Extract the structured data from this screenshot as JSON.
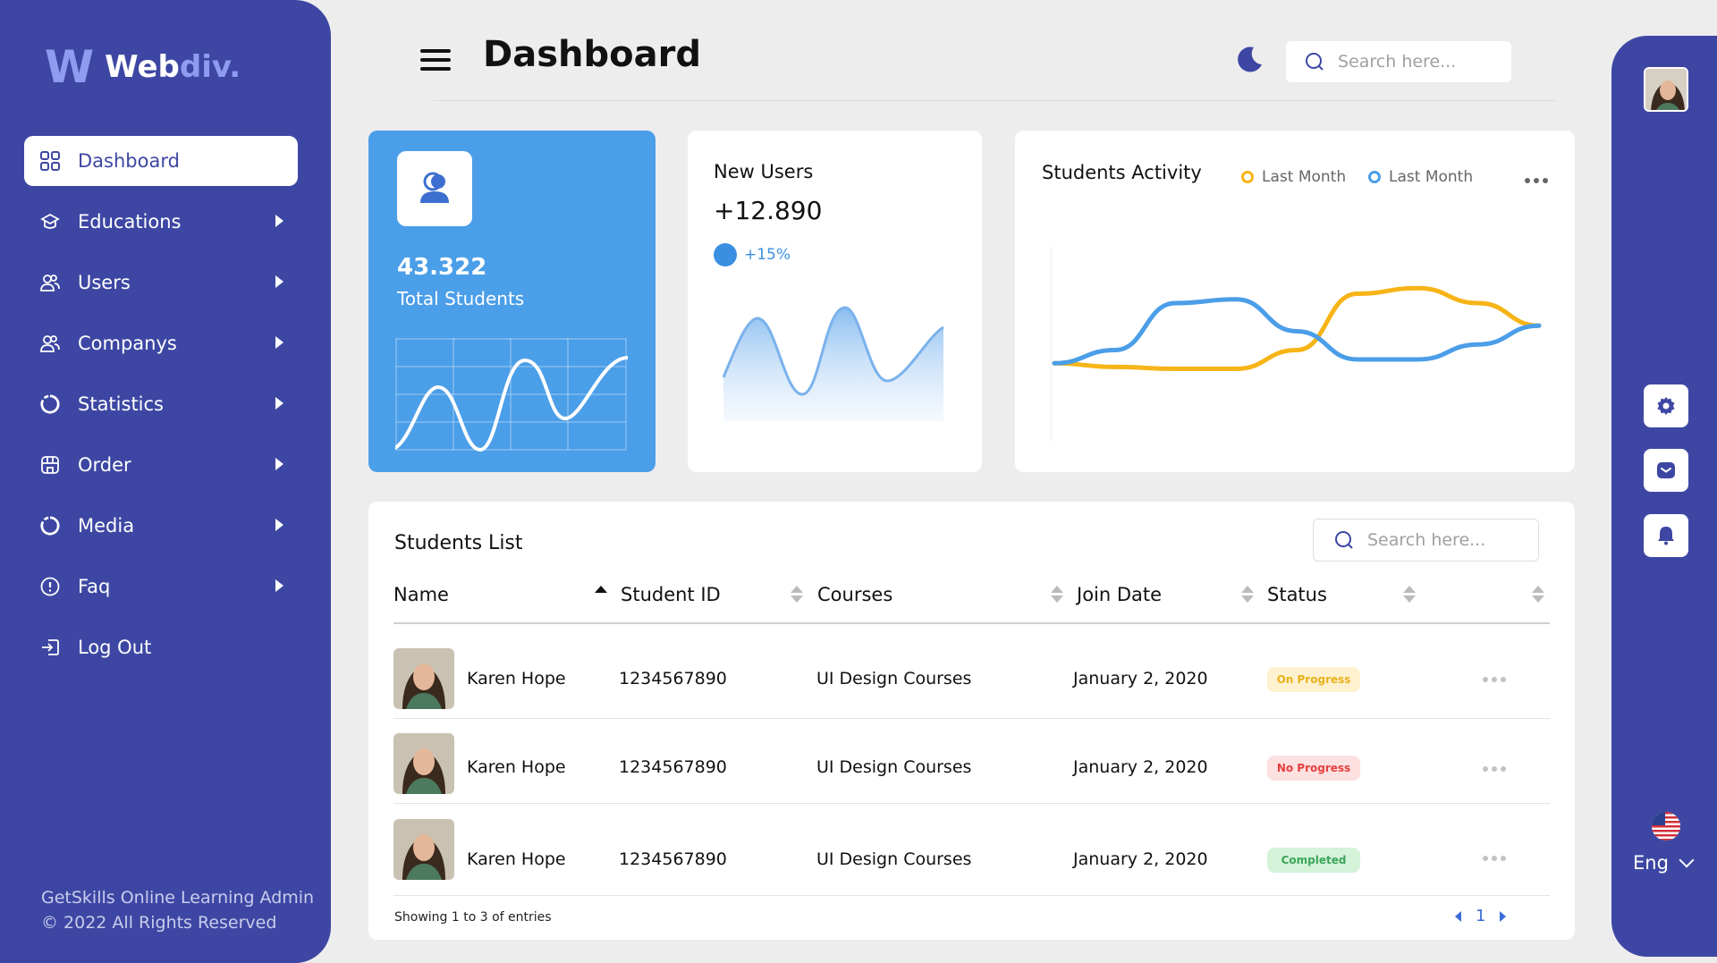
{
  "brand": {
    "mark": "W",
    "name_main": "Web",
    "name_accent": "div."
  },
  "sidebar": {
    "items": [
      {
        "label": "Dashboard",
        "icon": "grid-icon",
        "active": true
      },
      {
        "label": "Educations",
        "icon": "graduation-cap-icon"
      },
      {
        "label": "Users",
        "icon": "users-icon"
      },
      {
        "label": "Companys",
        "icon": "users-icon"
      },
      {
        "label": "Statistics",
        "icon": "pie-chart-icon"
      },
      {
        "label": "Order",
        "icon": "store-icon"
      },
      {
        "label": "Media",
        "icon": "pie-chart-icon"
      },
      {
        "label": "Faq",
        "icon": "info-circle-icon"
      },
      {
        "label": "Log Out",
        "icon": "logout-icon"
      }
    ],
    "footer_line1": "GetSkills Online Learning Admin",
    "footer_line2": "© 2022 All Rights Reserved"
  },
  "header": {
    "title": "Dashboard",
    "search_placeholder": "Search here..."
  },
  "stats": {
    "total_students": {
      "value": "43.322",
      "label": "Total Students"
    },
    "new_users": {
      "title": "New Users",
      "value": "+12.890",
      "change": "+15%"
    }
  },
  "activity": {
    "title": "Students Activity",
    "legend": [
      {
        "label": "Last Month",
        "color": "#f6b417"
      },
      {
        "label": "Last Month",
        "color": "#4b9ee8"
      }
    ]
  },
  "chart_data": {
    "type": "line",
    "title": "Students Activity",
    "x": [
      0,
      1,
      2,
      3,
      4,
      5,
      6,
      7,
      8
    ],
    "series": [
      {
        "name": "Last Month",
        "color": "#f6b417",
        "values": [
          38,
          36,
          35,
          35,
          45,
          75,
          78,
          70,
          58
        ]
      },
      {
        "name": "Last Month",
        "color": "#4b9ee8",
        "values": [
          38,
          45,
          70,
          72,
          55,
          40,
          40,
          48,
          58
        ]
      }
    ],
    "ylim": [
      0,
      100
    ],
    "grid": false
  },
  "table": {
    "title": "Students List",
    "search_placeholder": "Search here...",
    "columns": [
      "Name",
      "Student ID",
      "Courses",
      "Join Date",
      "Status"
    ],
    "rows": [
      {
        "name": "Karen Hope",
        "id": "1234567890",
        "course": "UI Design Courses",
        "date": "January 2, 2020",
        "status": "On Progress",
        "status_bg": "#fdf1cf",
        "status_color": "#eab21a"
      },
      {
        "name": "Karen Hope",
        "id": "1234567890",
        "course": "UI Design Courses",
        "date": "January 2, 2020",
        "status": "No Progress",
        "status_bg": "#fde0e0",
        "status_color": "#e5403d"
      },
      {
        "name": "Karen Hope",
        "id": "1234567890",
        "course": "UI Design Courses",
        "date": "January 2, 2020",
        "status": "Completed",
        "status_bg": "#d4f3d9",
        "status_color": "#3aa65a"
      }
    ],
    "showing": "Showing 1 to 3 of entries",
    "page": "1"
  },
  "rail": {
    "language": "Eng"
  },
  "colors": {
    "sidebar": "#3d47a3",
    "accent_blue": "#4b9ee8",
    "accent_yellow": "#f6b417",
    "logo_accent": "#8f9bf0"
  }
}
